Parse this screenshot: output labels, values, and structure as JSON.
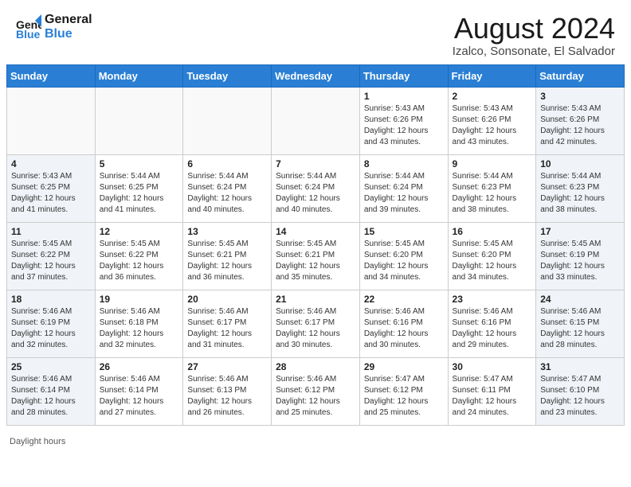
{
  "header": {
    "logo_line1": "General",
    "logo_line2": "Blue",
    "month_year": "August 2024",
    "location": "Izalco, Sonsonate, El Salvador"
  },
  "days_of_week": [
    "Sunday",
    "Monday",
    "Tuesday",
    "Wednesday",
    "Thursday",
    "Friday",
    "Saturday"
  ],
  "weeks": [
    [
      {
        "day": "",
        "info": ""
      },
      {
        "day": "",
        "info": ""
      },
      {
        "day": "",
        "info": ""
      },
      {
        "day": "",
        "info": ""
      },
      {
        "day": "1",
        "info": "Sunrise: 5:43 AM\nSunset: 6:26 PM\nDaylight: 12 hours\nand 43 minutes."
      },
      {
        "day": "2",
        "info": "Sunrise: 5:43 AM\nSunset: 6:26 PM\nDaylight: 12 hours\nand 43 minutes."
      },
      {
        "day": "3",
        "info": "Sunrise: 5:43 AM\nSunset: 6:26 PM\nDaylight: 12 hours\nand 42 minutes."
      }
    ],
    [
      {
        "day": "4",
        "info": "Sunrise: 5:43 AM\nSunset: 6:25 PM\nDaylight: 12 hours\nand 41 minutes."
      },
      {
        "day": "5",
        "info": "Sunrise: 5:44 AM\nSunset: 6:25 PM\nDaylight: 12 hours\nand 41 minutes."
      },
      {
        "day": "6",
        "info": "Sunrise: 5:44 AM\nSunset: 6:24 PM\nDaylight: 12 hours\nand 40 minutes."
      },
      {
        "day": "7",
        "info": "Sunrise: 5:44 AM\nSunset: 6:24 PM\nDaylight: 12 hours\nand 40 minutes."
      },
      {
        "day": "8",
        "info": "Sunrise: 5:44 AM\nSunset: 6:24 PM\nDaylight: 12 hours\nand 39 minutes."
      },
      {
        "day": "9",
        "info": "Sunrise: 5:44 AM\nSunset: 6:23 PM\nDaylight: 12 hours\nand 38 minutes."
      },
      {
        "day": "10",
        "info": "Sunrise: 5:44 AM\nSunset: 6:23 PM\nDaylight: 12 hours\nand 38 minutes."
      }
    ],
    [
      {
        "day": "11",
        "info": "Sunrise: 5:45 AM\nSunset: 6:22 PM\nDaylight: 12 hours\nand 37 minutes."
      },
      {
        "day": "12",
        "info": "Sunrise: 5:45 AM\nSunset: 6:22 PM\nDaylight: 12 hours\nand 36 minutes."
      },
      {
        "day": "13",
        "info": "Sunrise: 5:45 AM\nSunset: 6:21 PM\nDaylight: 12 hours\nand 36 minutes."
      },
      {
        "day": "14",
        "info": "Sunrise: 5:45 AM\nSunset: 6:21 PM\nDaylight: 12 hours\nand 35 minutes."
      },
      {
        "day": "15",
        "info": "Sunrise: 5:45 AM\nSunset: 6:20 PM\nDaylight: 12 hours\nand 34 minutes."
      },
      {
        "day": "16",
        "info": "Sunrise: 5:45 AM\nSunset: 6:20 PM\nDaylight: 12 hours\nand 34 minutes."
      },
      {
        "day": "17",
        "info": "Sunrise: 5:45 AM\nSunset: 6:19 PM\nDaylight: 12 hours\nand 33 minutes."
      }
    ],
    [
      {
        "day": "18",
        "info": "Sunrise: 5:46 AM\nSunset: 6:19 PM\nDaylight: 12 hours\nand 32 minutes."
      },
      {
        "day": "19",
        "info": "Sunrise: 5:46 AM\nSunset: 6:18 PM\nDaylight: 12 hours\nand 32 minutes."
      },
      {
        "day": "20",
        "info": "Sunrise: 5:46 AM\nSunset: 6:17 PM\nDaylight: 12 hours\nand 31 minutes."
      },
      {
        "day": "21",
        "info": "Sunrise: 5:46 AM\nSunset: 6:17 PM\nDaylight: 12 hours\nand 30 minutes."
      },
      {
        "day": "22",
        "info": "Sunrise: 5:46 AM\nSunset: 6:16 PM\nDaylight: 12 hours\nand 30 minutes."
      },
      {
        "day": "23",
        "info": "Sunrise: 5:46 AM\nSunset: 6:16 PM\nDaylight: 12 hours\nand 29 minutes."
      },
      {
        "day": "24",
        "info": "Sunrise: 5:46 AM\nSunset: 6:15 PM\nDaylight: 12 hours\nand 28 minutes."
      }
    ],
    [
      {
        "day": "25",
        "info": "Sunrise: 5:46 AM\nSunset: 6:14 PM\nDaylight: 12 hours\nand 28 minutes."
      },
      {
        "day": "26",
        "info": "Sunrise: 5:46 AM\nSunset: 6:14 PM\nDaylight: 12 hours\nand 27 minutes."
      },
      {
        "day": "27",
        "info": "Sunrise: 5:46 AM\nSunset: 6:13 PM\nDaylight: 12 hours\nand 26 minutes."
      },
      {
        "day": "28",
        "info": "Sunrise: 5:46 AM\nSunset: 6:12 PM\nDaylight: 12 hours\nand 25 minutes."
      },
      {
        "day": "29",
        "info": "Sunrise: 5:47 AM\nSunset: 6:12 PM\nDaylight: 12 hours\nand 25 minutes."
      },
      {
        "day": "30",
        "info": "Sunrise: 5:47 AM\nSunset: 6:11 PM\nDaylight: 12 hours\nand 24 minutes."
      },
      {
        "day": "31",
        "info": "Sunrise: 5:47 AM\nSunset: 6:10 PM\nDaylight: 12 hours\nand 23 minutes."
      }
    ]
  ],
  "footer": {
    "daylight_label": "Daylight hours"
  }
}
